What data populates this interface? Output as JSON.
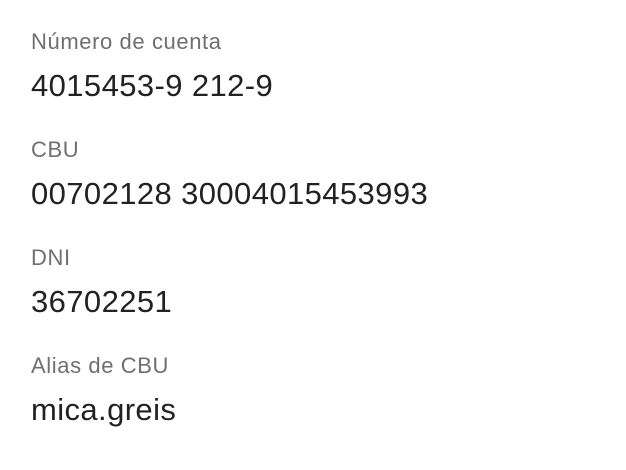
{
  "account_details": {
    "fields": [
      {
        "label": "Número de cuenta",
        "value": "4015453-9 212-9"
      },
      {
        "label": "CBU",
        "value": "00702128 30004015453993"
      },
      {
        "label": "DNI",
        "value": "36702251"
      },
      {
        "label": "Alias de CBU",
        "value": "mica.greis"
      }
    ]
  }
}
